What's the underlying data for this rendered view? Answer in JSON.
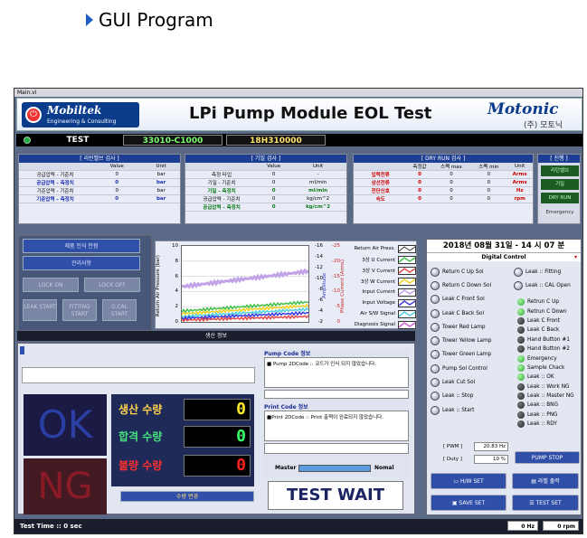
{
  "heading": "GUI Program",
  "window": {
    "title": "Main.vi"
  },
  "banner": {
    "company": "Mobiltek",
    "company_sub": "Engineering & Consulting",
    "title": "LPi Pump Module EOL Test",
    "brand": "Motonic",
    "brand_kr": "(주) 모토닉"
  },
  "info": {
    "mode": "TEST",
    "model": "33010-C1000",
    "serial": "18H310000"
  },
  "leak_panel": {
    "title": "[ 리턴밸브 검사 ]",
    "cols": [
      "",
      "Value",
      "Unit"
    ],
    "rows": [
      {
        "label": "공급압력 - 기준치",
        "value": "0",
        "unit": "bar",
        "cls": ""
      },
      {
        "label": "공급압력 - 측정치",
        "value": "0",
        "unit": "bar",
        "cls": "blue"
      },
      {
        "label": "기준압력 - 기준치",
        "value": "0",
        "unit": "bar",
        "cls": ""
      },
      {
        "label": "기준압력 - 측정치",
        "value": "0",
        "unit": "bar",
        "cls": "blue"
      }
    ]
  },
  "air_panel": {
    "title": "[ 기밀 검사 ]",
    "cols": [
      "",
      "Value",
      "Unit"
    ],
    "rows": [
      {
        "label": "측정 타입",
        "value": "0",
        "unit": "-",
        "cls": ""
      },
      {
        "label": "기밀 - 기준치",
        "value": "0",
        "unit": "ml/min",
        "cls": ""
      },
      {
        "label": "기밀 - 측정치",
        "value": "0",
        "unit": "ml/min",
        "cls": "green"
      },
      {
        "label": "공급압력 - 기준치",
        "value": "0",
        "unit": "kg/cm^2",
        "cls": ""
      },
      {
        "label": "공급압력 - 측정치",
        "value": "0",
        "unit": "kg/cm^2",
        "cls": "green"
      }
    ]
  },
  "dry_panel": {
    "title": "[ DRY RUN 검사 ]",
    "cols": [
      "",
      "측정값",
      "스펙 max",
      "스펙 min",
      "Unit"
    ],
    "rows": [
      {
        "label": "입력전류",
        "value": "0",
        "max": "0",
        "min": "0",
        "unit": "Arms"
      },
      {
        "label": "상선전류",
        "value": "0",
        "max": "0",
        "min": "0",
        "unit": "Arms"
      },
      {
        "label": "전단신호",
        "value": "0",
        "max": "0",
        "min": "0",
        "unit": "Hz"
      },
      {
        "label": "속도",
        "value": "0",
        "max": "0",
        "min": "0",
        "unit": "rpm"
      }
    ]
  },
  "progress_panel": {
    "title": "[ 진행 ]",
    "items": [
      "리턴밸브",
      "기밀",
      "DRY RUN",
      "Emergency"
    ]
  },
  "left_buttons": {
    "product": "제품 인식 안됨",
    "manage": "관리사항",
    "lock_on": "LOCK ON",
    "lock_off": "LOCK OFF",
    "leak": "LEAK START",
    "fitting": "FITTING START",
    "ocal": "O.CAL START"
  },
  "chart_data": {
    "type": "line",
    "ylabel_left": "Return Air Pressure (bar)",
    "ylabel_mid": "Amplitude",
    "ylabel_right": "Phase Current (Arms)",
    "y_left_ticks": [
      "10",
      "8",
      "6",
      "4",
      "2",
      "0"
    ],
    "y_mid_ticks": [
      "-16",
      "-14",
      "-12",
      "-10",
      "-8",
      "-6",
      "-4",
      "-2"
    ],
    "y_right_ticks": [
      "-25",
      "-20",
      "-15",
      "-10",
      "-5",
      "0"
    ],
    "series": [
      {
        "name": "Return Air Press.",
        "color": "#ffffff"
      },
      {
        "name": "3상 U Current",
        "color": "#3fbf4a"
      },
      {
        "name": "3상 V Current",
        "color": "#e04848"
      },
      {
        "name": "3상 W Current",
        "color": "#f0d020"
      },
      {
        "name": "Input Current",
        "color": "#c2a3e8"
      },
      {
        "name": "Input Voltage",
        "color": "#3a3ae0"
      },
      {
        "name": "Air S/W Signal",
        "color": "#50d0e0"
      },
      {
        "name": "Diagnosis Signal",
        "color": "#d060d0"
      }
    ]
  },
  "status_strip": {
    "label": "생산 정보"
  },
  "counts": {
    "produce_label": "생산 수량",
    "produce": "0",
    "pass_label": "합격 수량",
    "pass": "0",
    "fail_label": "불량 수량",
    "fail": "0",
    "change_button": "수량 변경",
    "ok": "OK",
    "ng": "NG"
  },
  "pump_code": {
    "title": "Pump Code 정보",
    "text": "■ Pump 2DCode :: 코드가 인식 되지 않았습니다."
  },
  "print_code": {
    "title": "Print Code 정보",
    "text": "■Print 2DCode :: Print 출력이 완료되지 않았습니다.",
    "master": "Master",
    "normal": "Nomal"
  },
  "test_state": "TEST WAIT",
  "right_panel": {
    "datetime": "2018년 08월 31일 - 14 시 07 분",
    "control": "Digital Control",
    "buttons_left": [
      "Return C Up Sol",
      "Return C Down Sol",
      "Leak C Front Sol",
      "Leak C Back Sol",
      "Tower Red Lamp",
      "Tower Yellow Lamp",
      "Tower Green Lamp",
      "Pump Sol Control",
      "Leak Cut Sol",
      "Leak :: Stop",
      "Leak :: Start"
    ],
    "buttons_right": [
      "Leak :: Fitting",
      "Leak :: CAL Open"
    ],
    "lamps": [
      {
        "label": "Retrun C Up",
        "on": true
      },
      {
        "label": "Retrun C Down",
        "on": true
      },
      {
        "label": "Leak C Front",
        "on": false
      },
      {
        "label": "Leak C Back",
        "on": false
      },
      {
        "label": "Hand Button #1",
        "on": false
      },
      {
        "label": "Hand Button #2",
        "on": false
      },
      {
        "label": "Emergency",
        "on": true
      },
      {
        "label": "Sample Chack",
        "on": true
      },
      {
        "label": "Leak :: OK",
        "on": true
      },
      {
        "label": "Leak :: Work NG",
        "on": false
      },
      {
        "label": "Leak :: Master NG",
        "on": false
      },
      {
        "label": "Leak :: BNG",
        "on": false
      },
      {
        "label": "Leak :: PNG",
        "on": false
      },
      {
        "label": "Leak :: RDY",
        "on": false
      }
    ],
    "pwm_label": "[ PWM ]",
    "pwm": "20.83 Hz",
    "duty_label": "[ Duty ]",
    "duty": "10 %",
    "pump_stop": "PUMP STOP"
  },
  "action_buttons": {
    "hw_set": "H/W SET",
    "label_print": "라벨 출력",
    "save_set": "SAVE SET",
    "test_set": "TEST SET"
  },
  "footer": {
    "test_time": "Test Time :: 0 sec",
    "hz": "0 Hz",
    "rpm": "0 rpm"
  }
}
